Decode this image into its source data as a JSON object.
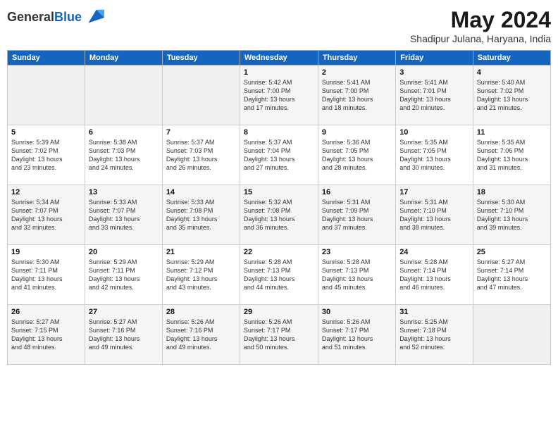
{
  "header": {
    "logo_general": "General",
    "logo_blue": "Blue",
    "month": "May 2024",
    "location": "Shadipur Julana, Haryana, India"
  },
  "days_of_week": [
    "Sunday",
    "Monday",
    "Tuesday",
    "Wednesday",
    "Thursday",
    "Friday",
    "Saturday"
  ],
  "weeks": [
    [
      {
        "day": "",
        "info": ""
      },
      {
        "day": "",
        "info": ""
      },
      {
        "day": "",
        "info": ""
      },
      {
        "day": "1",
        "info": "Sunrise: 5:42 AM\nSunset: 7:00 PM\nDaylight: 13 hours\nand 17 minutes."
      },
      {
        "day": "2",
        "info": "Sunrise: 5:41 AM\nSunset: 7:00 PM\nDaylight: 13 hours\nand 18 minutes."
      },
      {
        "day": "3",
        "info": "Sunrise: 5:41 AM\nSunset: 7:01 PM\nDaylight: 13 hours\nand 20 minutes."
      },
      {
        "day": "4",
        "info": "Sunrise: 5:40 AM\nSunset: 7:02 PM\nDaylight: 13 hours\nand 21 minutes."
      }
    ],
    [
      {
        "day": "5",
        "info": "Sunrise: 5:39 AM\nSunset: 7:02 PM\nDaylight: 13 hours\nand 23 minutes."
      },
      {
        "day": "6",
        "info": "Sunrise: 5:38 AM\nSunset: 7:03 PM\nDaylight: 13 hours\nand 24 minutes."
      },
      {
        "day": "7",
        "info": "Sunrise: 5:37 AM\nSunset: 7:03 PM\nDaylight: 13 hours\nand 26 minutes."
      },
      {
        "day": "8",
        "info": "Sunrise: 5:37 AM\nSunset: 7:04 PM\nDaylight: 13 hours\nand 27 minutes."
      },
      {
        "day": "9",
        "info": "Sunrise: 5:36 AM\nSunset: 7:05 PM\nDaylight: 13 hours\nand 28 minutes."
      },
      {
        "day": "10",
        "info": "Sunrise: 5:35 AM\nSunset: 7:05 PM\nDaylight: 13 hours\nand 30 minutes."
      },
      {
        "day": "11",
        "info": "Sunrise: 5:35 AM\nSunset: 7:06 PM\nDaylight: 13 hours\nand 31 minutes."
      }
    ],
    [
      {
        "day": "12",
        "info": "Sunrise: 5:34 AM\nSunset: 7:07 PM\nDaylight: 13 hours\nand 32 minutes."
      },
      {
        "day": "13",
        "info": "Sunrise: 5:33 AM\nSunset: 7:07 PM\nDaylight: 13 hours\nand 33 minutes."
      },
      {
        "day": "14",
        "info": "Sunrise: 5:33 AM\nSunset: 7:08 PM\nDaylight: 13 hours\nand 35 minutes."
      },
      {
        "day": "15",
        "info": "Sunrise: 5:32 AM\nSunset: 7:08 PM\nDaylight: 13 hours\nand 36 minutes."
      },
      {
        "day": "16",
        "info": "Sunrise: 5:31 AM\nSunset: 7:09 PM\nDaylight: 13 hours\nand 37 minutes."
      },
      {
        "day": "17",
        "info": "Sunrise: 5:31 AM\nSunset: 7:10 PM\nDaylight: 13 hours\nand 38 minutes."
      },
      {
        "day": "18",
        "info": "Sunrise: 5:30 AM\nSunset: 7:10 PM\nDaylight: 13 hours\nand 39 minutes."
      }
    ],
    [
      {
        "day": "19",
        "info": "Sunrise: 5:30 AM\nSunset: 7:11 PM\nDaylight: 13 hours\nand 41 minutes."
      },
      {
        "day": "20",
        "info": "Sunrise: 5:29 AM\nSunset: 7:11 PM\nDaylight: 13 hours\nand 42 minutes."
      },
      {
        "day": "21",
        "info": "Sunrise: 5:29 AM\nSunset: 7:12 PM\nDaylight: 13 hours\nand 43 minutes."
      },
      {
        "day": "22",
        "info": "Sunrise: 5:28 AM\nSunset: 7:13 PM\nDaylight: 13 hours\nand 44 minutes."
      },
      {
        "day": "23",
        "info": "Sunrise: 5:28 AM\nSunset: 7:13 PM\nDaylight: 13 hours\nand 45 minutes."
      },
      {
        "day": "24",
        "info": "Sunrise: 5:28 AM\nSunset: 7:14 PM\nDaylight: 13 hours\nand 46 minutes."
      },
      {
        "day": "25",
        "info": "Sunrise: 5:27 AM\nSunset: 7:14 PM\nDaylight: 13 hours\nand 47 minutes."
      }
    ],
    [
      {
        "day": "26",
        "info": "Sunrise: 5:27 AM\nSunset: 7:15 PM\nDaylight: 13 hours\nand 48 minutes."
      },
      {
        "day": "27",
        "info": "Sunrise: 5:27 AM\nSunset: 7:16 PM\nDaylight: 13 hours\nand 49 minutes."
      },
      {
        "day": "28",
        "info": "Sunrise: 5:26 AM\nSunset: 7:16 PM\nDaylight: 13 hours\nand 49 minutes."
      },
      {
        "day": "29",
        "info": "Sunrise: 5:26 AM\nSunset: 7:17 PM\nDaylight: 13 hours\nand 50 minutes."
      },
      {
        "day": "30",
        "info": "Sunrise: 5:26 AM\nSunset: 7:17 PM\nDaylight: 13 hours\nand 51 minutes."
      },
      {
        "day": "31",
        "info": "Sunrise: 5:25 AM\nSunset: 7:18 PM\nDaylight: 13 hours\nand 52 minutes."
      },
      {
        "day": "",
        "info": ""
      }
    ]
  ]
}
